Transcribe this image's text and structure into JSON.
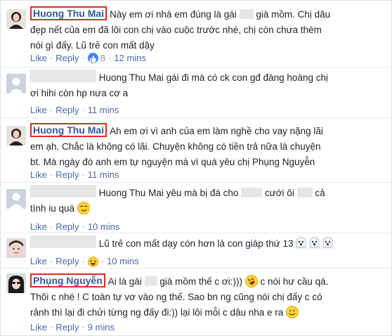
{
  "comments": [
    {
      "name": "Huong Thu Mai",
      "line1_a": "Này em ơi nhà em đúng là gái",
      "line1_b": "già mồm. Chị dâu",
      "line2": "đẹp nết của em đã lôi con chị vào cuộc trước nhé, chị còn chưa thèm",
      "line3": "nói gì đấy. Lũ trẻ con mất dậy",
      "like": "Like",
      "reply": "Reply",
      "like_count": "8",
      "time": "12 mins"
    },
    {
      "text_a": "Huong Thu Mai gái đi mà có ck con gđ đàng hoàng chị",
      "text_b": "ơi hihi còn hp nưa cơ a",
      "like": "Like",
      "reply": "Reply",
      "time": "11 mins"
    },
    {
      "name": "Huong Thu Mai",
      "line1": "Ah em ơi vì anh của em làm nghề cho vay nặng lãi",
      "line2": "em ạh. Chắc là không có lãi. Chuyện không có tiền trả nữa là chuyện",
      "line3": "bt. Mà ngày đó anh em tự nguyện mà vì quá yêu chị Phụng Nguyễn",
      "like": "Like",
      "reply": "Reply",
      "time": "11 mins"
    },
    {
      "text_a": "Huong Thu Mai yêu mà bị đá cho",
      "text_b": "cưới ôi",
      "text_c": "cả",
      "text_d": "tình iu quá",
      "like": "Like",
      "reply": "Reply",
      "time": "10 mins"
    },
    {
      "text": "Lũ trẻ con mất dạy còn hơn là con giáp thứ 13",
      "like": "Like",
      "reply": "Reply",
      "time": "10 mins"
    },
    {
      "name": "Phụng Nguyễn",
      "line1_a": "Ai là gái",
      "line1_b": "già mồm thế c ơi:)))",
      "line1_c": "c nói hư cầu qá.",
      "line2": "Thôi c nhé ! C toàn tự vơ vào ng thế. Sao bn ng cũng nói chị đấy c có",
      "line3": "rảnh thì lại đi chửi từng ng đấy đi:)) lại lôi mỗi c dâu nha e ra",
      "like": "Like",
      "reply": "Reply",
      "time": "9 mins"
    }
  ],
  "colors": {
    "name_box": "#e02b27",
    "name_text": "#365899",
    "link": "#4b6aa7",
    "meta": "#90949c",
    "like_icon": "#4a83ff"
  }
}
